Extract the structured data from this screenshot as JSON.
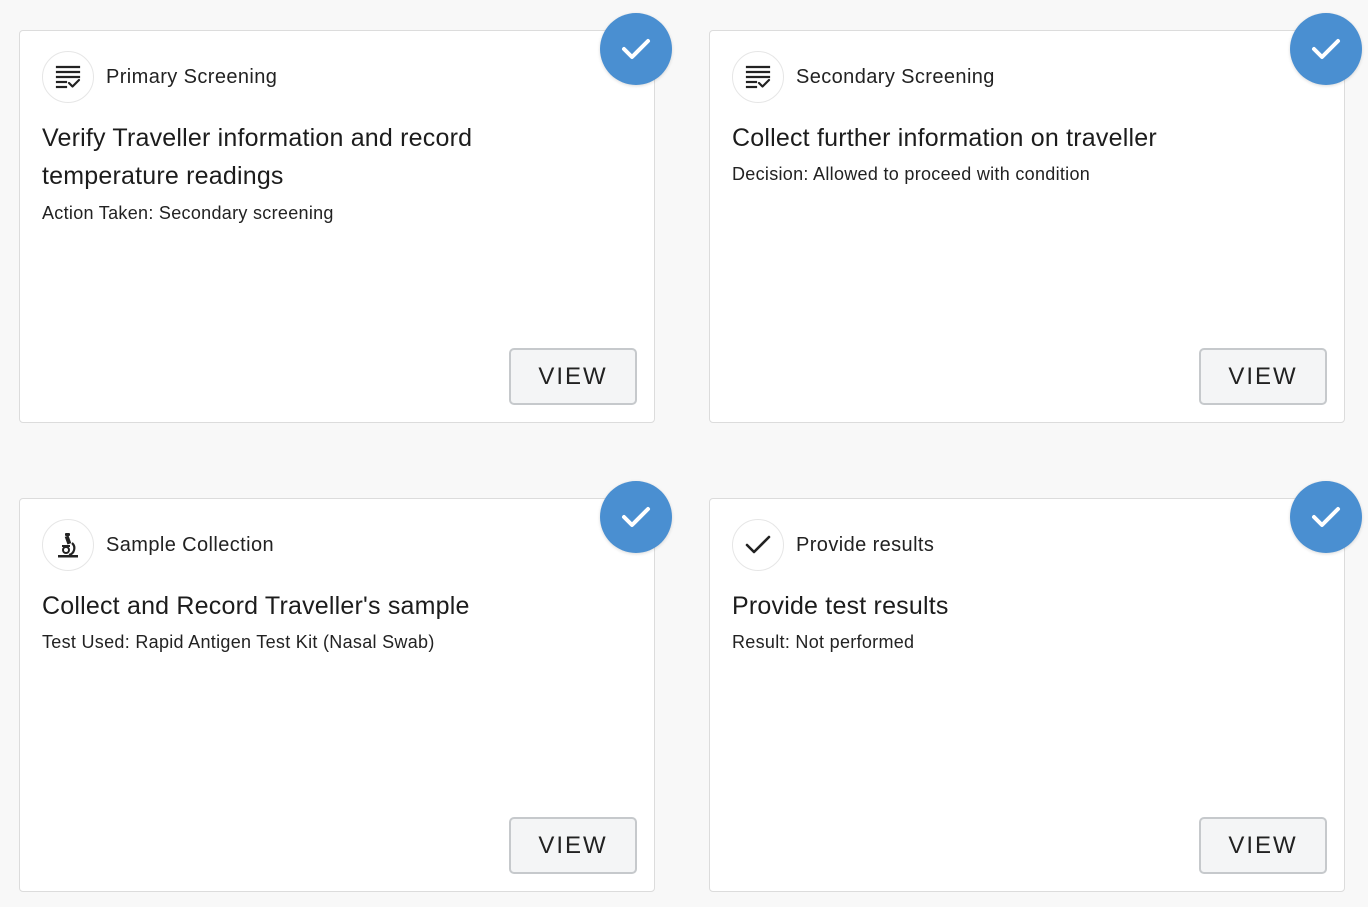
{
  "button_label": "VIEW",
  "colors": {
    "accent": "#4a8fd1",
    "card_border": "#dcdcdc",
    "background": "#f8f8f8"
  },
  "cards": [
    {
      "step": "Primary Screening",
      "icon": "checklist-icon",
      "title": "Verify Traveller information and record temperature readings",
      "detail": "Action Taken: Secondary screening",
      "completed": true
    },
    {
      "step": "Secondary Screening",
      "icon": "checklist-icon",
      "title": "Collect further information on traveller",
      "detail": "Decision: Allowed to proceed with condition",
      "completed": true
    },
    {
      "step": "Sample Collection",
      "icon": "microscope-icon",
      "title": "Collect and Record Traveller's sample",
      "detail": "Test Used: Rapid Antigen Test Kit (Nasal Swab)",
      "completed": true
    },
    {
      "step": "Provide results",
      "icon": "checkmark-icon",
      "title": "Provide test results",
      "detail": "Result: Not performed",
      "completed": true
    }
  ]
}
